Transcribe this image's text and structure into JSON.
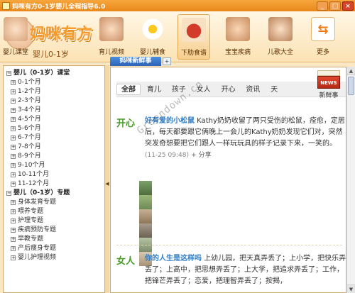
{
  "window": {
    "title": "妈咪有方0-1岁婴儿全程指导6.0",
    "minimize": "_",
    "maximize": "□",
    "close": "×"
  },
  "logo": {
    "text": "妈咪有方",
    "subtitle": "婴儿0-1岁"
  },
  "nav": {
    "items": [
      {
        "label": "婴儿课堂",
        "icon": "baby-classroom-icon"
      },
      {
        "label": "育儿视频",
        "icon": "video-baby-icon"
      },
      {
        "label": "婴儿辅食",
        "icon": "fried-egg-icon"
      },
      {
        "label": "下肋食谱",
        "icon": "cooking-pot-icon"
      },
      {
        "label": "宝宝疾病",
        "icon": "sick-baby-icon"
      },
      {
        "label": "儿歌大全",
        "icon": "headphone-baby-icon"
      },
      {
        "label": "更多",
        "icon": "refresh-arrows-icon"
      }
    ],
    "more_glyph": "⇆"
  },
  "sidebar": {
    "section1": "婴儿（0-1岁）课堂",
    "months": [
      "0-1个月",
      "1-2个月",
      "2-3个月",
      "3-4个月",
      "4-5个月",
      "5-6个月",
      "6-7个月",
      "7-8个月",
      "8-9个月",
      "9-10个月",
      "10-11个月",
      "11-12个月"
    ],
    "section2": "婴儿（0-1岁）专题",
    "topics": [
      "身体发育专题",
      "喂养专题",
      "护理专题",
      "疾病预防专题",
      "早教专题",
      "产后瘦身专题",
      "婴儿护理视频"
    ],
    "expand_glyph": "+",
    "collapse_glyph": "−"
  },
  "tabs": {
    "active": "妈咪新鲜事",
    "add_glyph": "+"
  },
  "categories": [
    "全部",
    "育儿",
    "孩子",
    "女人",
    "开心",
    "资讯",
    "天"
  ],
  "news_badge": {
    "paper": "NEWS",
    "label": "新鲜事"
  },
  "posts": [
    {
      "mood": "开心",
      "title": "好有爱的小松鼠",
      "text": " Kathy奶奶收留了两只受伤的松鼠，痊愈，定居后，每天都要跟它俩晚上一会儿的Kathy奶奶发现它们对，突然突发奇想要把它们跟人一样玩玩具的样子记录下来，一笑的。",
      "meta": "(11-25 09:48)",
      "share": "+ 分享"
    },
    {
      "mood": "女人",
      "title": "你的人生是这样吗",
      "text": " 上幼儿园，把天真弄丢了；上小学，把快乐弄丢了；上高中，把思想弄丢了；上大学，把追求弄丢了；工作，把锋芒弄丢了；恋爱，把理智弄丢了；按揭，"
    }
  ],
  "watermark": "Greendown.cn",
  "scroll": {
    "up": "▲",
    "down": "▼"
  },
  "splitter_glyph": "◀"
}
